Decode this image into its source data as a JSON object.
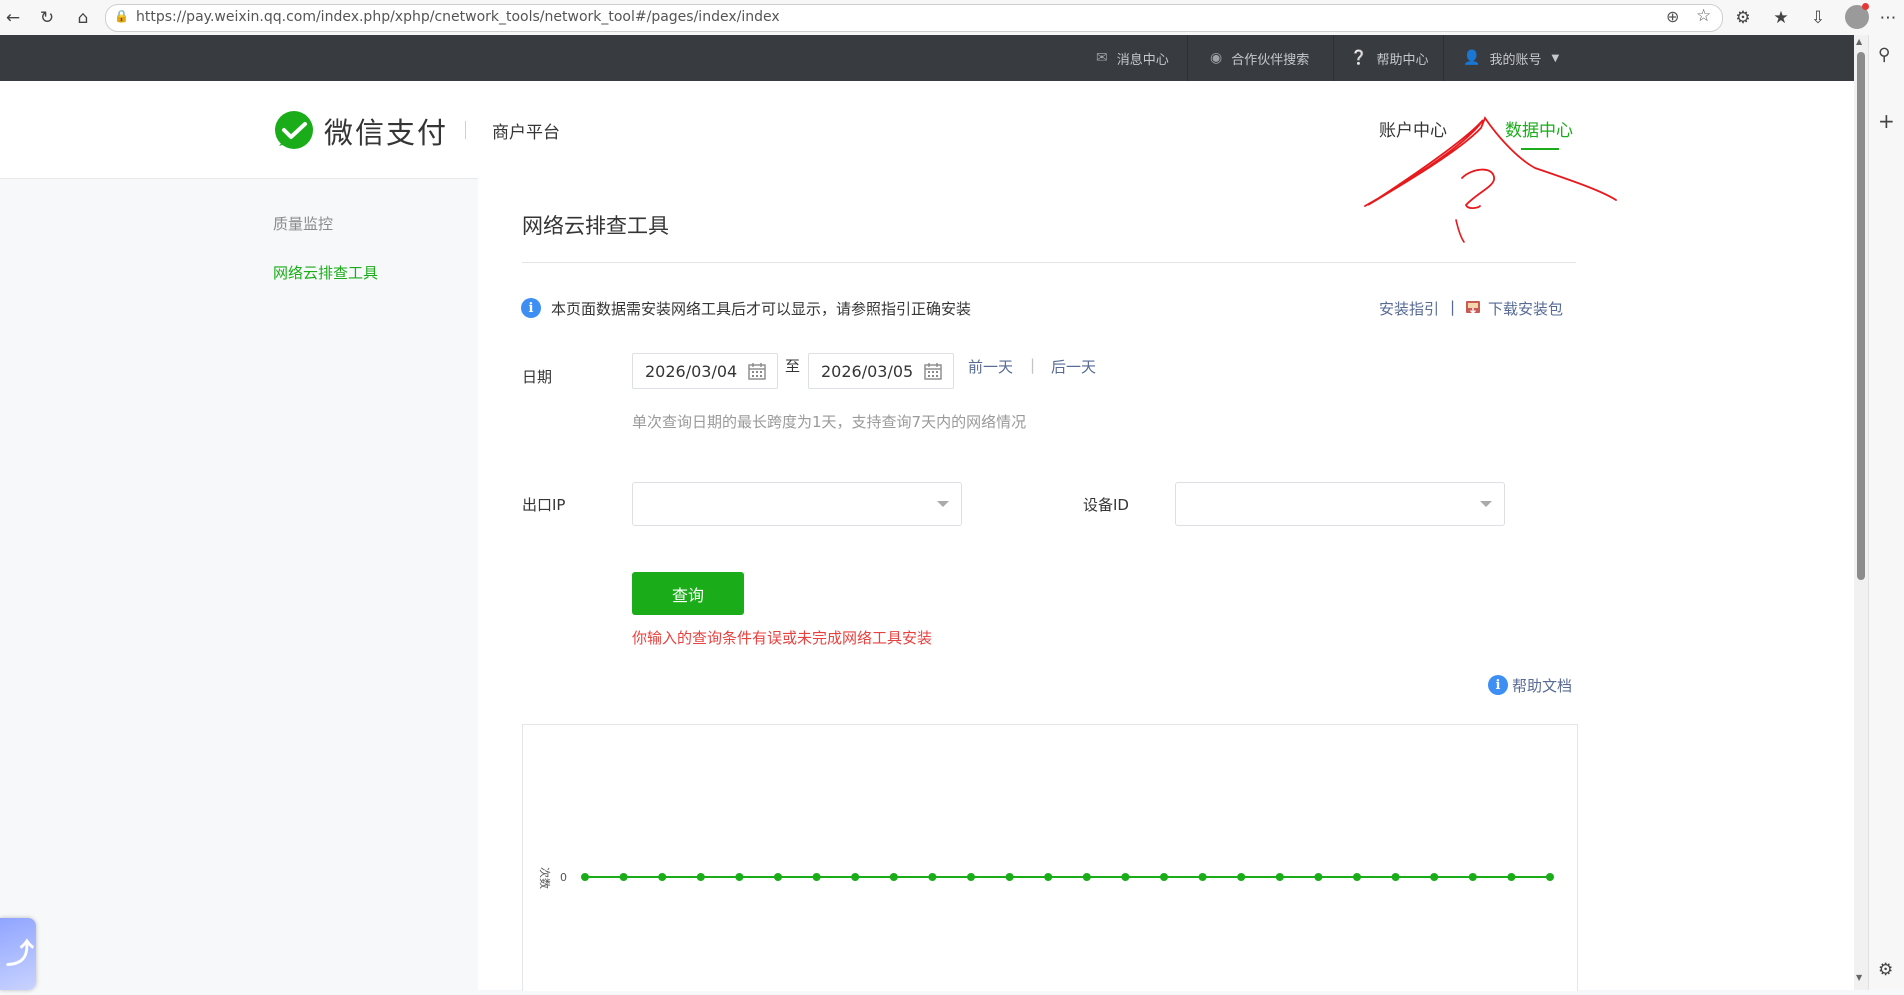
{
  "browser": {
    "url": "https://pay.weixin.qq.com/index.php/xphp/cnetwork_tools/network_tool#/pages/index/index"
  },
  "topbar": {
    "items": [
      {
        "label": "消息中心",
        "icon": "mail-icon"
      },
      {
        "label": "合作伙伴搜索",
        "icon": "search-circle-icon"
      },
      {
        "label": "帮助中心",
        "icon": "question-icon"
      },
      {
        "label": "我的账号",
        "icon": "user-icon"
      }
    ]
  },
  "header": {
    "brand": "微信支付",
    "platform": "商户平台",
    "nav": {
      "account": "账户中心",
      "data": "数据中心"
    }
  },
  "sidebar": {
    "items": [
      {
        "label": "质量监控",
        "active": false
      },
      {
        "label": "网络云排查工具",
        "active": true
      }
    ]
  },
  "main": {
    "title": "网络云排查工具",
    "notice": "本页面数据需安装网络工具后才可以显示，请参照指引正确安装",
    "install_guide": "安装指引",
    "separator": "|",
    "download": "下载安装包",
    "date_label": "日期",
    "date_start": "2026/03/04",
    "date_to": "至",
    "date_end": "2026/03/05",
    "prev_day": "前一天",
    "day_sep": "|",
    "next_day": "后一天",
    "date_hint": "单次查询日期的最长跨度为1天，支持查询7天内的网络情况",
    "ip_label": "出口IP",
    "ip_value": "",
    "device_label": "设备ID",
    "device_value": "",
    "query_button": "查询",
    "error": "你输入的查询条件有误或未完成网络工具安装",
    "help_doc": "帮助文档"
  },
  "chart_data": {
    "type": "line",
    "ylabel": "次数",
    "y_tick_labels": [
      "0"
    ],
    "series": [
      {
        "values": [
          0,
          0,
          0,
          0,
          0,
          0,
          0,
          0,
          0,
          0,
          0,
          0,
          0,
          0,
          0,
          0,
          0,
          0,
          0,
          0,
          0,
          0,
          0,
          0,
          0,
          0
        ]
      }
    ],
    "color": "#1aad19"
  },
  "annotation": {
    "text": "?",
    "color": "#e8191d"
  },
  "colors": {
    "brand_green": "#1aad19",
    "link_blue": "#576b95",
    "error_red": "#e64340",
    "topbar_bg": "#383b40"
  }
}
